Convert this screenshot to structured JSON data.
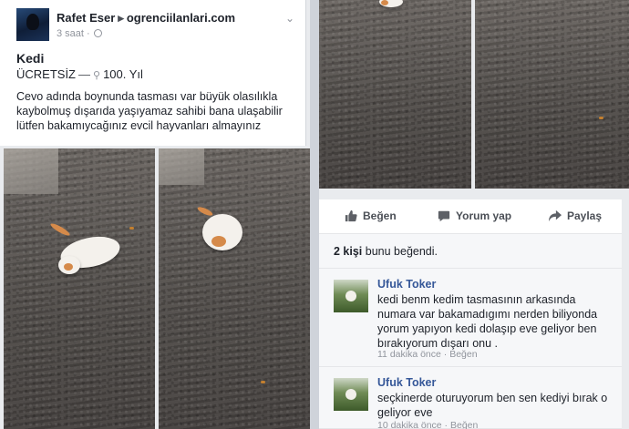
{
  "post": {
    "author": "Rafet Eser",
    "arrow": "▸",
    "page": "ogrenciilanlari.com",
    "time": "3 saat ·",
    "title": "Kedi",
    "price": "ÜCRETSİZ",
    "price_sep": "—",
    "location": "100. Yıl",
    "text": "Cevo adında boynunda tasması var büyük olasılıkla kaybolmuş dışarıda yaşıyamaz sahibi bana ulaşabilir lütfen bakamıycağınız evcil hayvanları almayınız"
  },
  "actions": {
    "like": "Beğen",
    "comment": "Yorum yap",
    "share": "Paylaş"
  },
  "likes": {
    "count": "2 kişi",
    "suffix": " bunu beğendi."
  },
  "comments": [
    {
      "name": "Ufuk Toker",
      "text": "kedi benm kedim tasmasının arkasında numara var bakamadıgımı nerden biliyonda yorum yapıyon kedi dolaşıp eve geliyor ben bırakıyorum dışarı onu .",
      "time": "11 dakika önce",
      "sep": " · ",
      "like": "Beğen"
    },
    {
      "name": "Ufuk Toker",
      "text": "seçkinerde oturuyorum ben sen kediyi bırak o geliyor eve",
      "time": "10 dakika önce",
      "sep": " · ",
      "like": "Beğen"
    }
  ],
  "icons": {
    "chevron": "chevron-down-icon",
    "globe": "globe-icon",
    "location": "location-pin-icon",
    "like": "thumbs-up-icon",
    "comment": "comment-bubble-icon",
    "share": "share-arrow-icon"
  }
}
